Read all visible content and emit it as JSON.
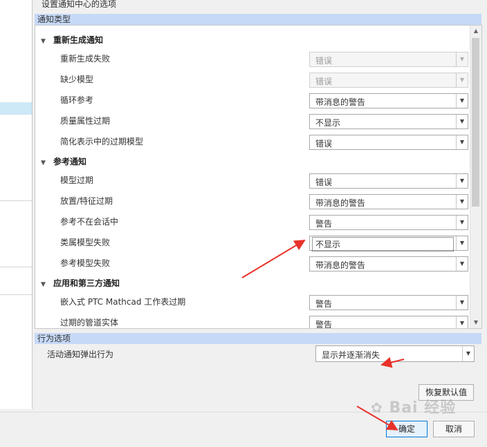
{
  "dialog": {
    "title": "设置通知中心的选项"
  },
  "notification_types": {
    "header": "通知类型",
    "groups": [
      {
        "title": "重新生成通知",
        "items": [
          {
            "label": "重新生成失败",
            "value": "错误",
            "disabled": true
          },
          {
            "label": "缺少模型",
            "value": "错误",
            "disabled": true
          },
          {
            "label": "循环参考",
            "value": "带消息的警告",
            "disabled": false
          },
          {
            "label": "质量属性过期",
            "value": "不显示",
            "disabled": false
          },
          {
            "label": "简化表示中的过期模型",
            "value": "错误",
            "disabled": false
          }
        ]
      },
      {
        "title": "参考通知",
        "items": [
          {
            "label": "模型过期",
            "value": "错误",
            "disabled": false
          },
          {
            "label": "放置/特征过期",
            "value": "带消息的警告",
            "disabled": false
          },
          {
            "label": "参考不在会话中",
            "value": "警告",
            "disabled": false
          },
          {
            "label": "类属模型失败",
            "value": "不显示",
            "disabled": false
          },
          {
            "label": "参考模型失败",
            "value": "带消息的警告",
            "disabled": false
          }
        ]
      },
      {
        "title": "应用和第三方通知",
        "items": [
          {
            "label": "嵌入式 PTC  Mathcad 工作表过期",
            "value": "警告",
            "disabled": false
          },
          {
            "label": "过期的管道实体",
            "value": "警告",
            "disabled": false
          }
        ]
      }
    ]
  },
  "behavior": {
    "header": "行为选项",
    "popup_label": "活动通知弹出行为",
    "popup_value": "显示并逐渐消失"
  },
  "buttons": {
    "restore_defaults": "恢复默认值",
    "ok": "确定",
    "cancel": "取消"
  },
  "watermark": {
    "text": "Bai  经验"
  },
  "colors": {
    "header_bg": "#c6d9f7",
    "annotation_red": "#e8322a",
    "default_button_border": "#0078d7"
  }
}
